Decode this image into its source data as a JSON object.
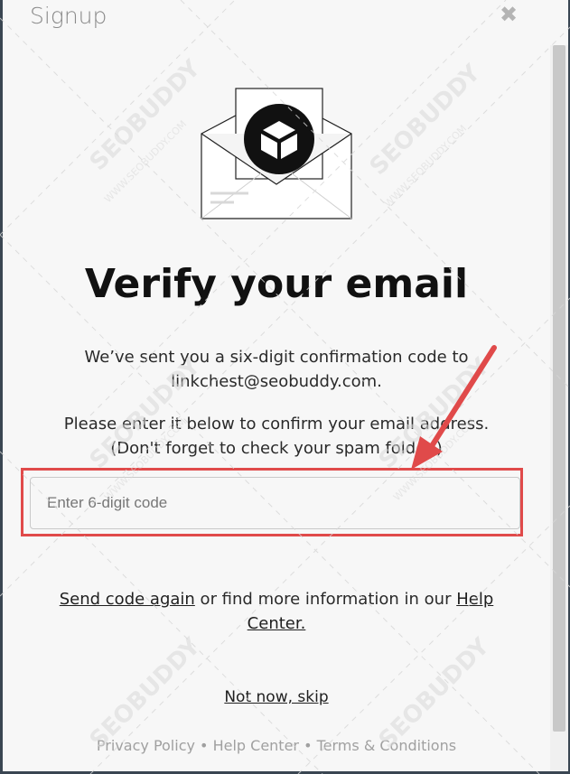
{
  "modal": {
    "title": "Signup",
    "close_symbol": "✖",
    "close_icon": "close-icon"
  },
  "illustration": {
    "icon": "envelope-with-cube-icon"
  },
  "heading": "Verify your email",
  "message": {
    "line1": "We’ve sent you a six-digit confirmation code to",
    "email": "linkchest@seobuddy.com.",
    "line3": "Please enter it below to confirm your email address.",
    "line4": "(Don't forget to check your spam folder.)"
  },
  "code_input": {
    "placeholder": "Enter 6-digit code",
    "value": ""
  },
  "help": {
    "resend_label": "Send code again",
    "middle_text": " or find more information in our ",
    "help_center_label": "Help Center."
  },
  "skip_label": "Not now, skip",
  "footer": {
    "privacy": "Privacy Policy",
    "separator": " • ",
    "help_center": "Help Center",
    "terms": "Terms & Conditions"
  },
  "colors": {
    "annotation_red": "#e04a4a"
  }
}
